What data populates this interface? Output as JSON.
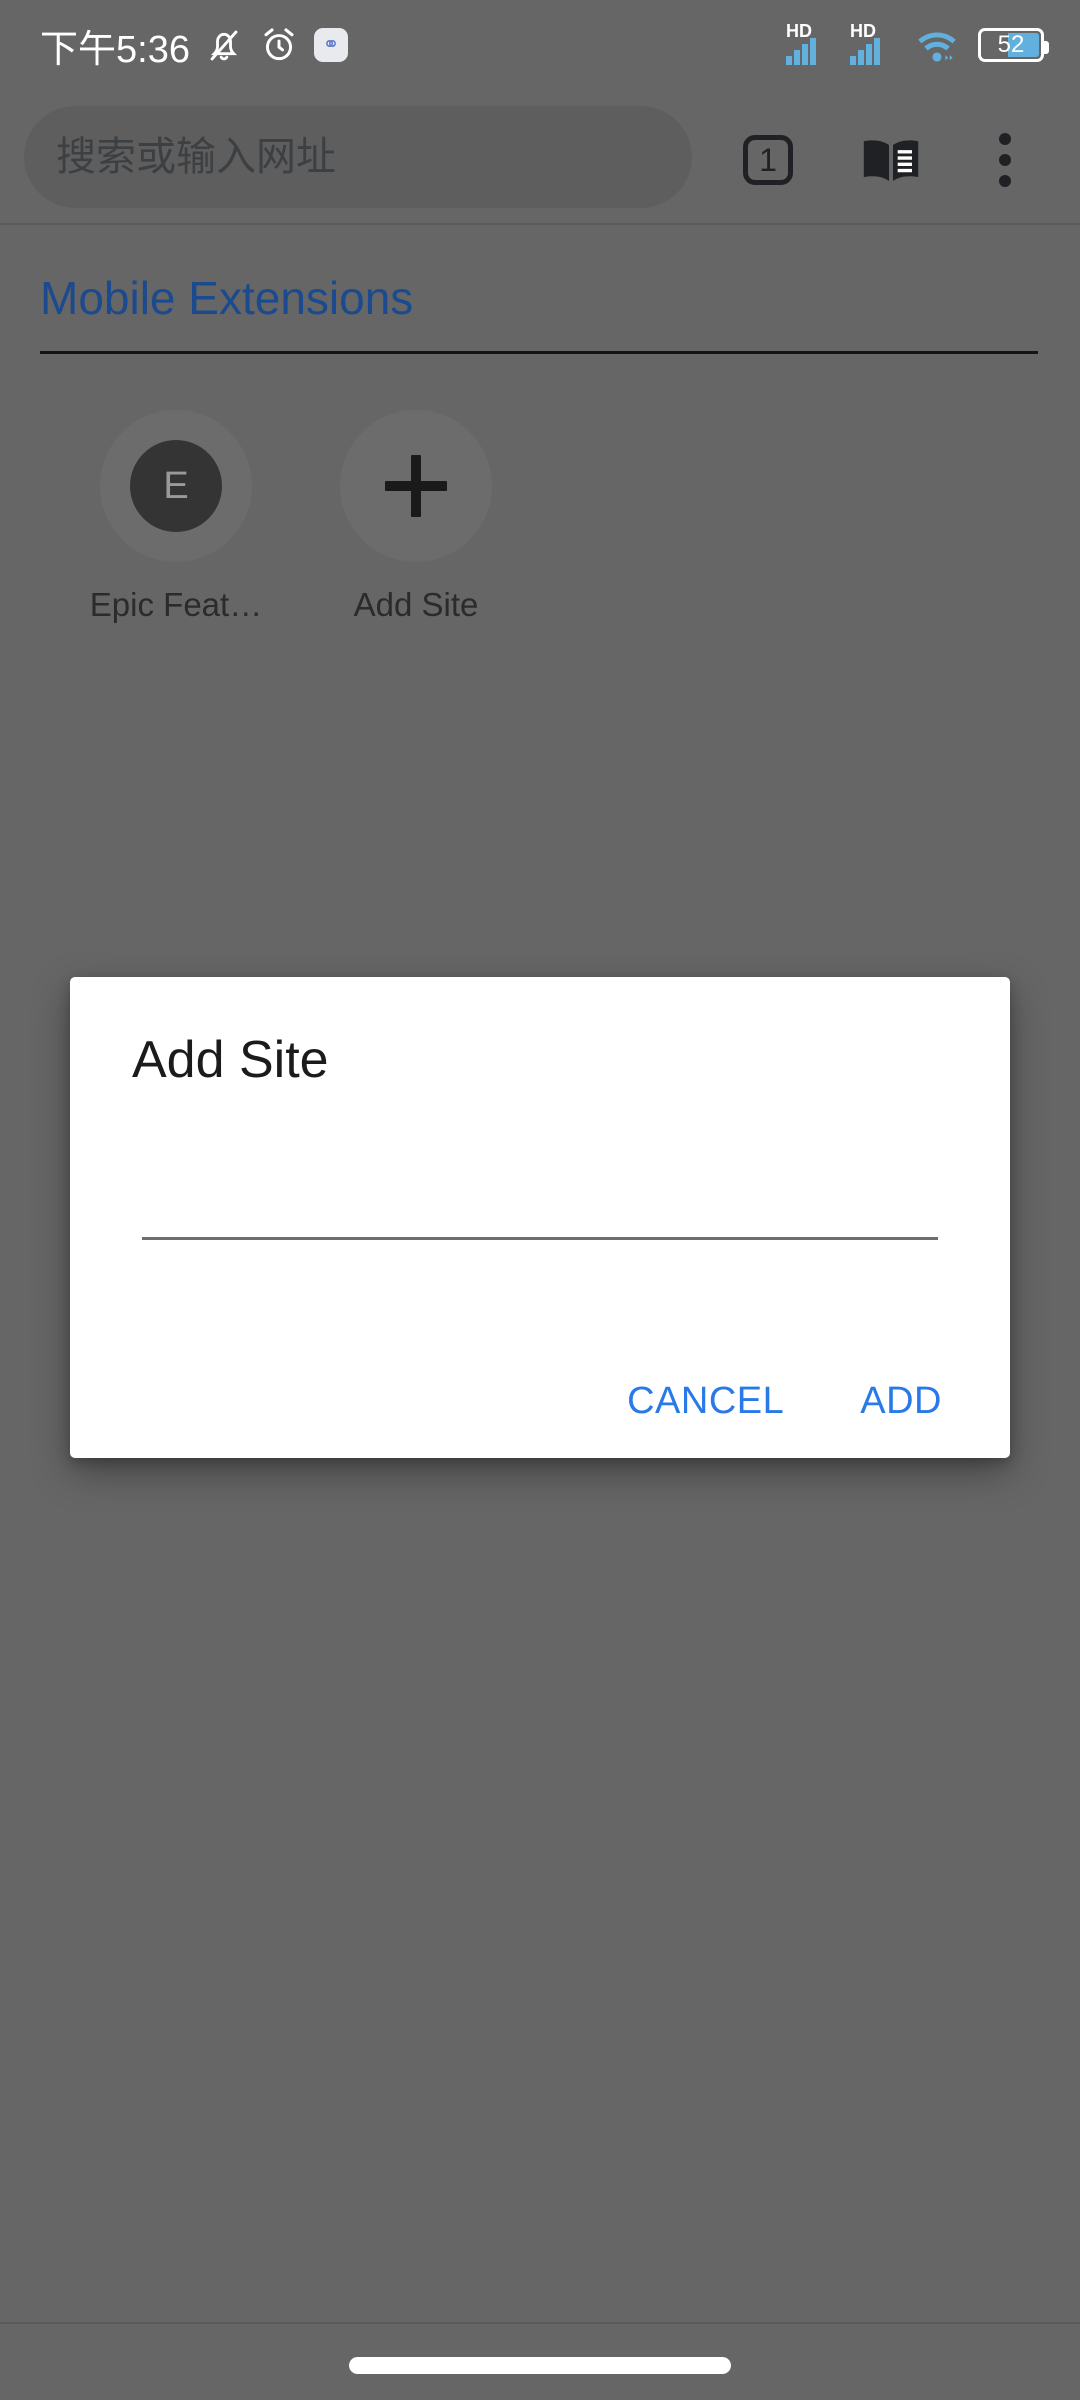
{
  "status_bar": {
    "clock": "下午5:36",
    "icons": [
      {
        "name": "notifications-silenced-icon",
        "glyph": "bell-slash"
      },
      {
        "name": "alarm-icon",
        "glyph": "alarm-clock"
      },
      {
        "name": "app-notification-icon",
        "glyph": "app-badge"
      }
    ],
    "signal_1_label": "HD",
    "signal_2_label": "HD",
    "wifi_label": "wifi",
    "battery_percent": "52",
    "battery_level": 52,
    "accent_color": "#62b0de"
  },
  "toolbar": {
    "omnibox_placeholder": "搜索或输入网址",
    "omnibox_value": "",
    "tab_count": "1",
    "reader_label": "reader-mode",
    "menu_label": "more-options"
  },
  "page": {
    "heading": "Mobile Extensions",
    "heading_color": "#1b4a8f",
    "tiles": [
      {
        "label": "Epic Feat…",
        "avatar_letter": "E",
        "type": "site"
      },
      {
        "label": "Add Site",
        "avatar_letter": "+",
        "type": "add"
      }
    ]
  },
  "dialog": {
    "title": "Add Site",
    "input_value": "",
    "input_placeholder": "",
    "cancel_label": "CANCEL",
    "add_label": "ADD",
    "button_color": "#2979e8"
  },
  "navbar": {
    "handle_label": "home-gesture-handle"
  },
  "theme": {
    "scrim_color": "#666666",
    "dialog_bg": "#ffffff"
  }
}
